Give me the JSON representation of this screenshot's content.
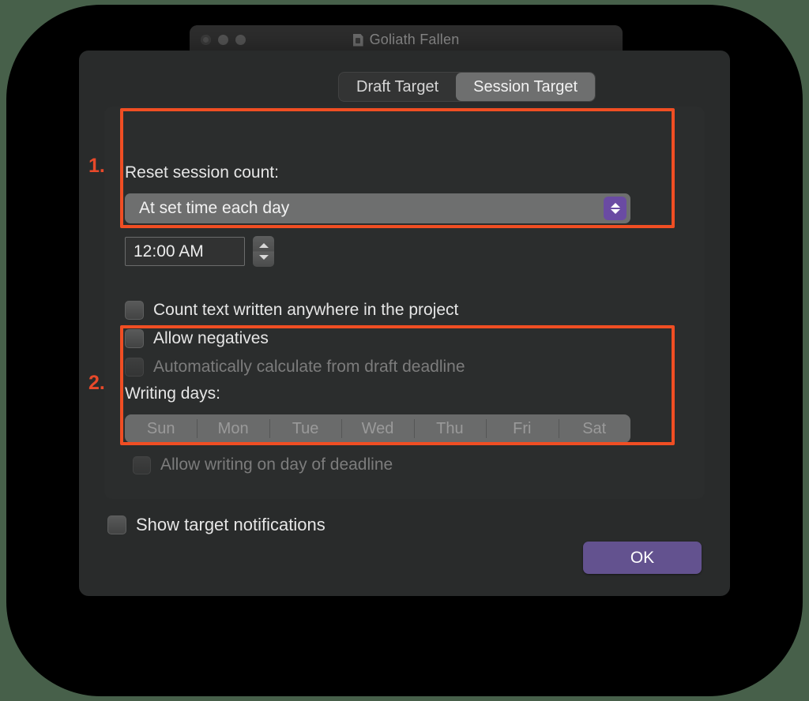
{
  "window": {
    "title": "Goliath Fallen",
    "doc_icon": "document-icon",
    "traffic_lights": [
      "close-button",
      "minimize-button",
      "zoom-button"
    ]
  },
  "tabs": [
    {
      "label": "Draft Target",
      "active": false
    },
    {
      "label": "Session Target",
      "active": true
    }
  ],
  "reset_section": {
    "heading": "Reset session count:",
    "popup": {
      "selected": "At set time each day",
      "stepper_icon": "chevron-up-down-icon"
    },
    "time": {
      "value": "12:00 AM",
      "stepper_icon": "stepper-up-down-icon"
    }
  },
  "options": [
    {
      "label": "Count text written anywhere in the project",
      "checked": false,
      "disabled": false
    },
    {
      "label": "Allow negatives",
      "checked": false,
      "disabled": false
    },
    {
      "label": "Automatically calculate from draft deadline",
      "checked": false,
      "disabled": true
    }
  ],
  "writing_days": {
    "heading": "Writing days:",
    "days": [
      "Sun",
      "Mon",
      "Tue",
      "Wed",
      "Thu",
      "Fri",
      "Sat"
    ],
    "deadline_option": {
      "label": "Allow writing on day of deadline",
      "checked": false,
      "disabled": true
    }
  },
  "notifications": {
    "label": "Show target notifications",
    "checked": false
  },
  "footer": {
    "ok_label": "OK"
  },
  "annotations": [
    {
      "number": "1."
    },
    {
      "number": "2."
    }
  ],
  "colors": {
    "accent_purple": "#63528f",
    "annotation_orange": "#f04e23",
    "sheet_bg": "#292b2b",
    "panel_bg": "#2b2d2d",
    "control_grey": "#6e6f6f"
  }
}
